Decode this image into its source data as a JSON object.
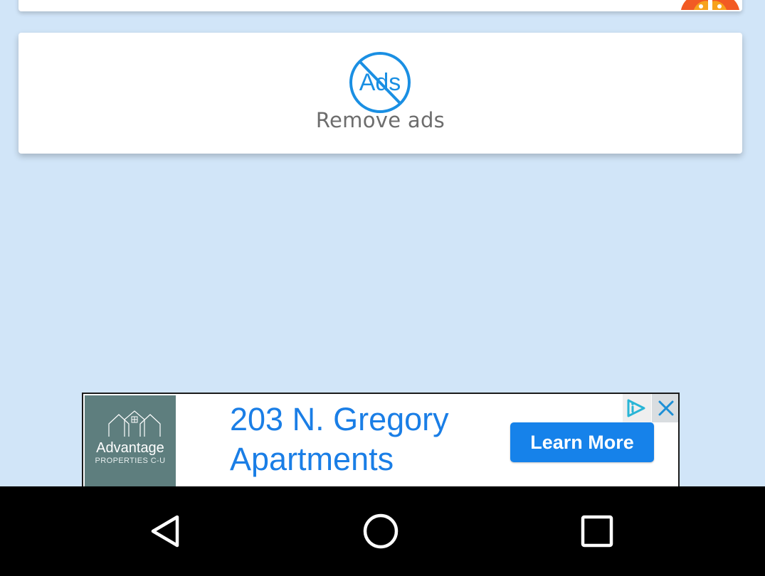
{
  "remove_ads": {
    "label": "Remove ads",
    "icon": "no-ads-icon",
    "icon_text": "Ads",
    "accent_color": "#1a8fe3"
  },
  "ad_banner": {
    "logo": {
      "name": "Advantage",
      "subtitle": "PROPERTIES C-U"
    },
    "headline": "203 N. Gregory Apartments",
    "cta_label": "Learn More",
    "adchoices_icon": "adchoices-icon",
    "close_icon": "close-icon",
    "text_color": "#1a7ee6",
    "button_color": "#1682ea"
  },
  "navigation": {
    "back_icon": "back-triangle-icon",
    "home_icon": "home-circle-icon",
    "recents_icon": "recents-square-icon"
  },
  "colors": {
    "background": "#d1e5f8",
    "card": "#ffffff",
    "nav_bar": "#000000"
  }
}
